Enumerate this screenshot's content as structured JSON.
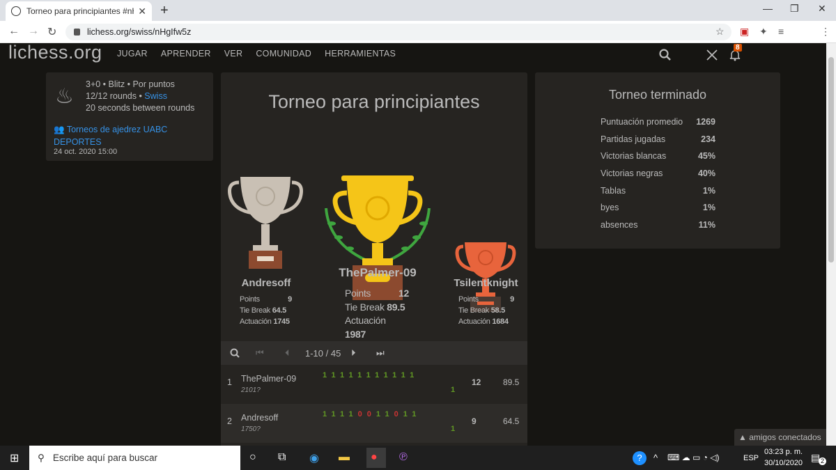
{
  "browser": {
    "tab_title": "Torneo para principiantes #nHgIf",
    "url": "lichess.org/swiss/nHgIfw5z"
  },
  "header": {
    "logo": "lichess.org",
    "nav": [
      "JUGAR",
      "APRENDER",
      "VER",
      "COMUNIDAD",
      "HERRAMIENTAS"
    ],
    "notification_count": "8"
  },
  "info": {
    "line1": "3+0 • Blitz • Por puntos",
    "line2a": "12/12 rounds • ",
    "line2b": "Swiss",
    "line3": "20 seconds between rounds",
    "team": "Torneos de ajedrez UABC DEPORTES",
    "date": "24 oct. 2020 15:00"
  },
  "podium": {
    "title": "Torneo para principiantes",
    "labels": {
      "points": "Points",
      "tiebreak": "Tie Break",
      "rating": "Actuación"
    },
    "first": {
      "name": "ThePalmer-09",
      "points": "12",
      "tiebreak": "89.5",
      "rating": "1987"
    },
    "second": {
      "name": "Andresoff",
      "points": "9",
      "tiebreak": "64.5",
      "rating": "1745"
    },
    "third": {
      "name": "Tsilentknight",
      "points": "9",
      "tiebreak": "58.5",
      "rating": "1684"
    }
  },
  "pager": {
    "label": "1-10 / 45"
  },
  "standings": [
    {
      "rank": "1",
      "name": "ThePalmer-09",
      "rating": "2101?",
      "results": [
        "1",
        "1",
        "1",
        "1",
        "1",
        "1",
        "1",
        "1",
        "1",
        "1",
        "1"
      ],
      "last": "1",
      "points": "12",
      "tiebreak": "89.5"
    },
    {
      "rank": "2",
      "name": "Andresoff",
      "rating": "1750?",
      "results": [
        "1",
        "1",
        "1",
        "1",
        "0",
        "0",
        "1",
        "1",
        "0",
        "1",
        "1"
      ],
      "last": "1",
      "points": "9",
      "tiebreak": "64.5"
    }
  ],
  "summary": {
    "title": "Torneo terminado",
    "rows": [
      {
        "label": "Puntuación promedio",
        "value": "1269"
      },
      {
        "label": "Partidas jugadas",
        "value": "234"
      },
      {
        "label": "Victorias blancas",
        "value": "45%"
      },
      {
        "label": "Victorias negras",
        "value": "40%"
      },
      {
        "label": "Tablas",
        "value": "1%"
      },
      {
        "label": "byes",
        "value": "1%"
      },
      {
        "label": "absences",
        "value": "11%"
      }
    ]
  },
  "friends": {
    "label": "amigos conectados"
  },
  "taskbar": {
    "search_placeholder": "Escribe aquí para buscar",
    "lang": "ESP",
    "time": "03:23 p. m.",
    "date": "30/10/2020",
    "notif": "2"
  },
  "colors": {
    "accent": "#3692e7",
    "win": "#629924",
    "loss": "#cc3333",
    "gold": "#f5c518",
    "silver": "#c9c0b4",
    "bronze": "#e8643c"
  }
}
